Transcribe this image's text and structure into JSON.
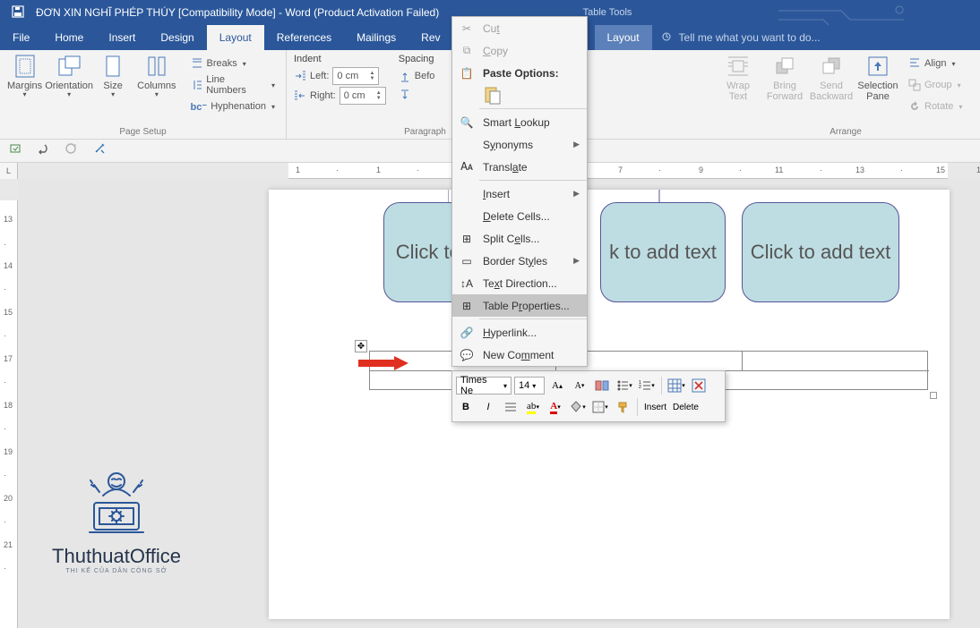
{
  "titlebar": {
    "text": "ĐƠN XIN NGHĨ PHÉP THÚY [Compatibility Mode] - Word (Product Activation Failed)",
    "table_tools": "Table Tools"
  },
  "tabs": {
    "file": "File",
    "home": "Home",
    "insert": "Insert",
    "design": "Design",
    "layout": "Layout",
    "references": "References",
    "mailings": "Mailings",
    "review": "Rev",
    "layout2": "Layout",
    "tellme": "Tell me what you want to do..."
  },
  "ribbon": {
    "page_setup": {
      "margins": "Margins",
      "orientation": "Orientation",
      "size": "Size",
      "columns": "Columns",
      "breaks": "Breaks",
      "line_numbers": "Line Numbers",
      "hyphenation": "Hyphenation",
      "group": "Page Setup"
    },
    "paragraph": {
      "indent": "Indent",
      "left": "Left:",
      "right": "Right:",
      "leftval": "0 cm",
      "rightval": "0 cm",
      "spacing": "Spacing",
      "before": "Befo",
      "group": "Paragraph"
    },
    "arrange": {
      "wrap": "Wrap Text",
      "bring": "Bring Forward",
      "send": "Send Backward",
      "selection": "Selection Pane",
      "align": "Align",
      "group_btn": "Group",
      "rotate": "Rotate",
      "group": "Arrange"
    }
  },
  "context_menu": {
    "cut": "Cut",
    "copy": "Copy",
    "paste_options": "Paste Options:",
    "smart_lookup": "Smart Lookup",
    "synonyms": "Synonyms",
    "translate": "Translate",
    "insert": "Insert",
    "delete_cells": "Delete Cells...",
    "split_cells": "Split Cells...",
    "border_styles": "Border Styles",
    "text_direction": "Text Direction...",
    "table_properties": "Table Properties...",
    "hyperlink": "Hyperlink...",
    "new_comment": "New Comment"
  },
  "shapes": {
    "s1": "Click to a",
    "s2": "k to add text",
    "s3": "Click to add text"
  },
  "minitool": {
    "font": "Times Ne",
    "size": "14",
    "insert": "Insert",
    "delete": "Delete"
  },
  "watermark": {
    "t1": "ThuthuatOffice",
    "t2": "THI KẾ CỦA DÂN CÔNG SỞ"
  },
  "ruler": {
    "corner": "L"
  }
}
